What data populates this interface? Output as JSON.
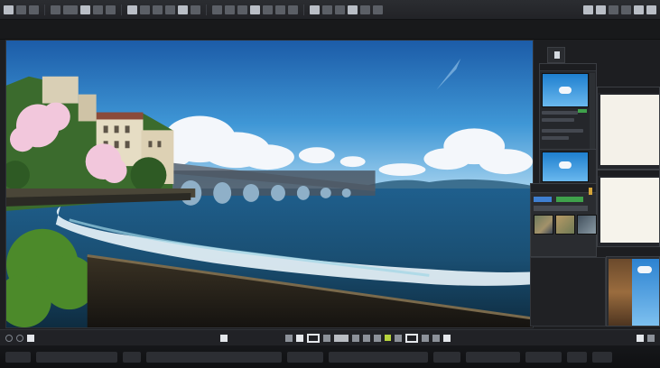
{
  "app": {
    "accent_color": "#3fa14b",
    "background_color": "#1d1e21"
  },
  "top_toolbar": {
    "icons": [
      "menu-icon",
      "file-icon",
      "brush-icon",
      "eraser-icon",
      "select-icon",
      "layers-icon",
      "zoom-icon",
      "settings-icon"
    ]
  },
  "canvas": {
    "content": "painting"
  },
  "panels": {
    "navigator": {
      "icons": [
        "thumbnail",
        "thumbnail"
      ]
    },
    "layers": {
      "icons": [
        "layer-thumbnail",
        "layer-thumbnail"
      ]
    },
    "color": {
      "active_color": "#3fa14b"
    }
  },
  "status_bar": {
    "icons": [
      "rotate-icon",
      "circle-icon",
      "square-icon",
      "brush-icon",
      "pen-icon",
      "color-swatch-icon",
      "frame-icon"
    ]
  }
}
